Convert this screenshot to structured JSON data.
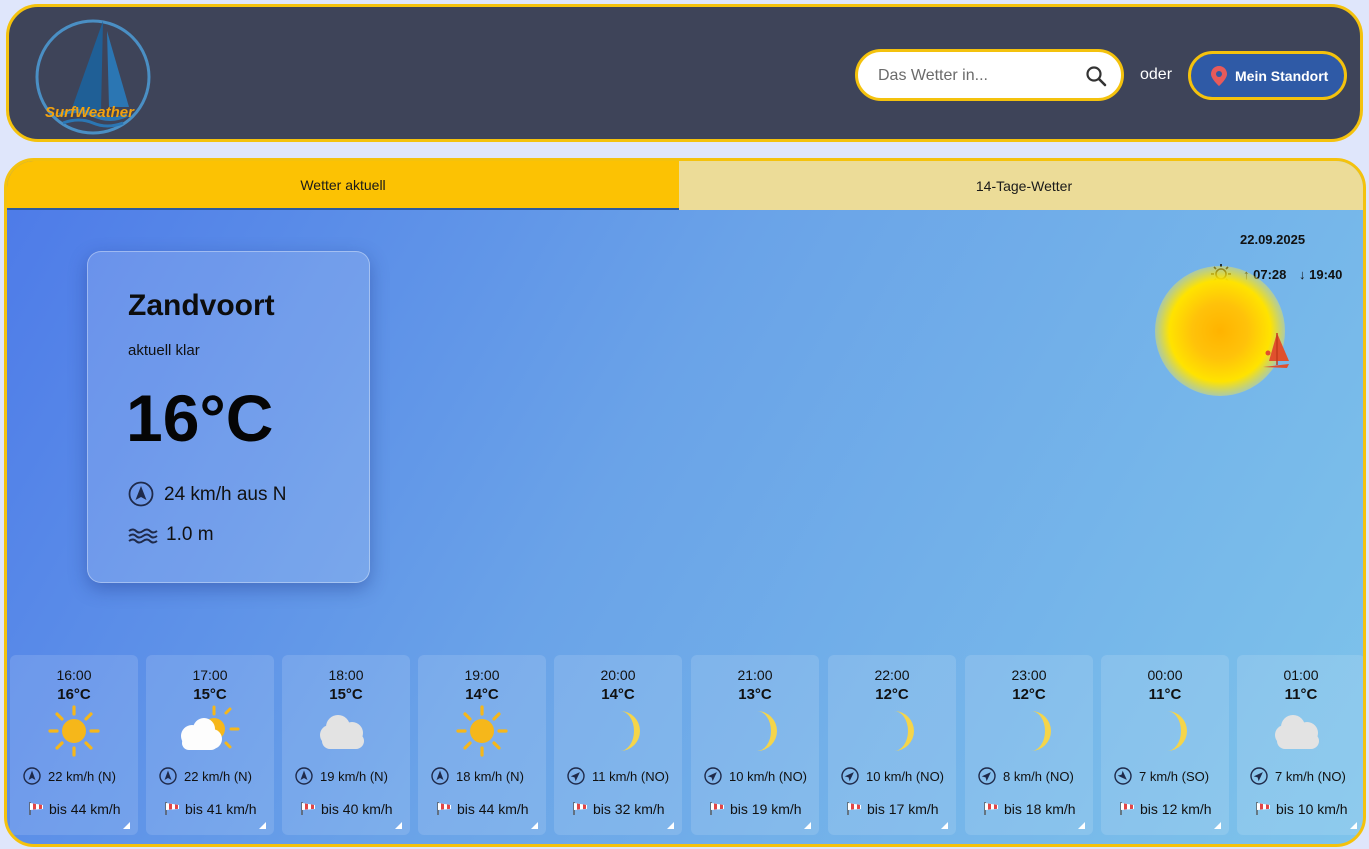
{
  "header": {
    "logo_text": "SurfWeather",
    "search_placeholder": "Das Wetter in...",
    "or_label": "oder",
    "location_button": "Mein Standort"
  },
  "tabs": [
    {
      "label": "Wetter aktuell",
      "active": true
    },
    {
      "label": "14-Tage-Wetter",
      "active": false
    }
  ],
  "sky": {
    "date": "22.09.2025",
    "sunrise": "↑ 07:28",
    "sunset": "↓ 19:40"
  },
  "current": {
    "city": "Zandvoort",
    "condition": "aktuell klar",
    "temperature": "16°C",
    "wind": "24 km/h aus N",
    "waves": "1.0 m"
  },
  "hourly": [
    {
      "time": "16:00",
      "temp": "16°C",
      "icon": "sun-icon",
      "wind": "22 km/h (N)",
      "gust": "bis 44 km/h"
    },
    {
      "time": "17:00",
      "temp": "15°C",
      "icon": "sun-cloud-icon",
      "wind": "22 km/h (N)",
      "gust": "bis 41 km/h"
    },
    {
      "time": "18:00",
      "temp": "15°C",
      "icon": "cloud-icon",
      "wind": "19 km/h (N)",
      "gust": "bis 40 km/h"
    },
    {
      "time": "19:00",
      "temp": "14°C",
      "icon": "sun-icon",
      "wind": "18 km/h (N)",
      "gust": "bis 44 km/h"
    },
    {
      "time": "20:00",
      "temp": "14°C",
      "icon": "moon-icon",
      "wind": "11 km/h (NO)",
      "gust": "bis 32 km/h"
    },
    {
      "time": "21:00",
      "temp": "13°C",
      "icon": "moon-icon",
      "wind": "10 km/h (NO)",
      "gust": "bis 19 km/h"
    },
    {
      "time": "22:00",
      "temp": "12°C",
      "icon": "moon-icon",
      "wind": "10 km/h (NO)",
      "gust": "bis 17 km/h"
    },
    {
      "time": "23:00",
      "temp": "12°C",
      "icon": "moon-icon",
      "wind": "8 km/h (NO)",
      "gust": "bis 18 km/h"
    },
    {
      "time": "00:00",
      "temp": "11°C",
      "icon": "moon-icon",
      "wind": "7 km/h (SO)",
      "gust": "bis 12 km/h"
    },
    {
      "time": "01:00",
      "temp": "11°C",
      "icon": "cloud-icon",
      "wind": "7 km/h (NO)",
      "gust": "bis 10 km/h"
    }
  ],
  "colors": {
    "header_bg": "#3e4459",
    "accent_yellow": "#f4c20d",
    "button_blue": "#2f5aa6",
    "tab_active": "#fcc203",
    "tab_inactive": "#ecdc98"
  }
}
